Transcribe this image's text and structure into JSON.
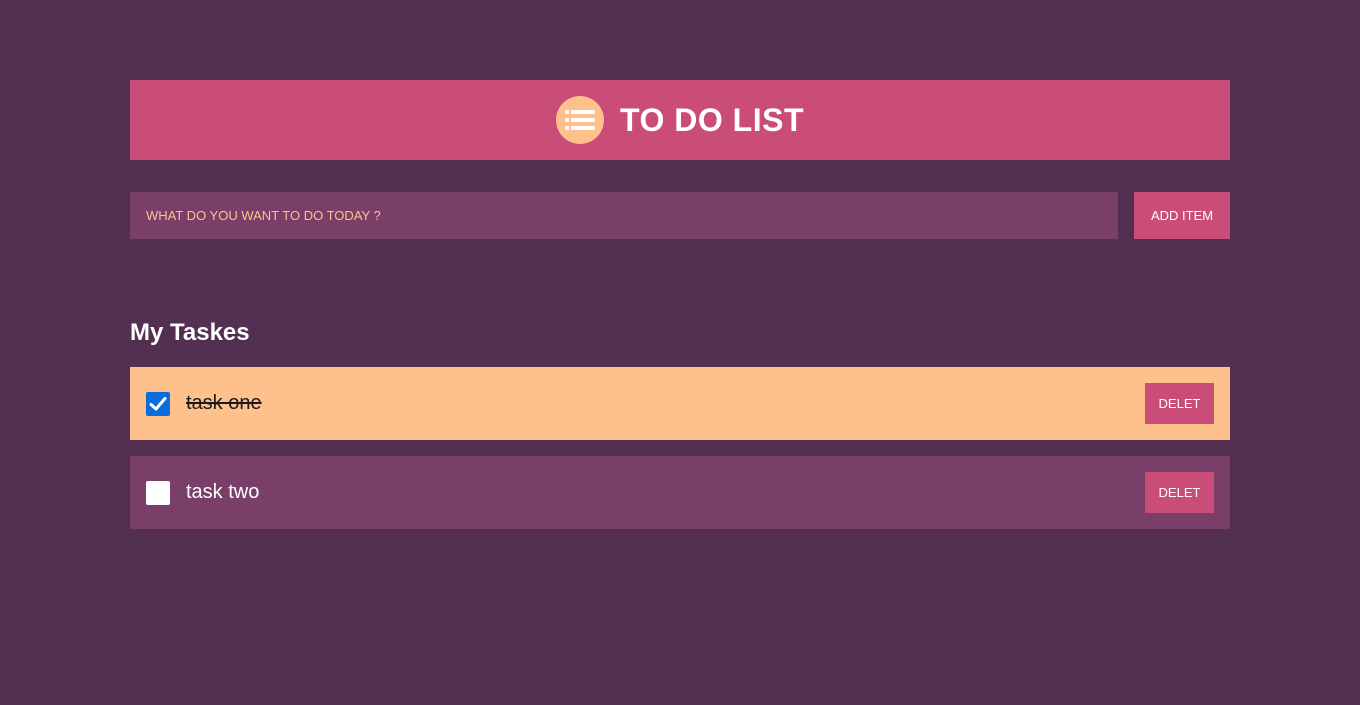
{
  "header": {
    "title": "TO DO LIST",
    "icon": "list-icon"
  },
  "add_form": {
    "placeholder": "WHAT DO YOU WANT TO DO TODAY ?",
    "value": "",
    "add_label": "ADD ITEM"
  },
  "tasks_section": {
    "title": "My Taskes"
  },
  "tasks": [
    {
      "label": "task one",
      "done": true,
      "delete_label": "DELET"
    },
    {
      "label": "task two",
      "done": false,
      "delete_label": "DELET"
    }
  ],
  "colors": {
    "background": "#533052",
    "accent": "#c94d78",
    "input_bg": "#7a3f69",
    "highlight": "#ffc18c",
    "checkbox_checked": "#0a6ddb"
  }
}
